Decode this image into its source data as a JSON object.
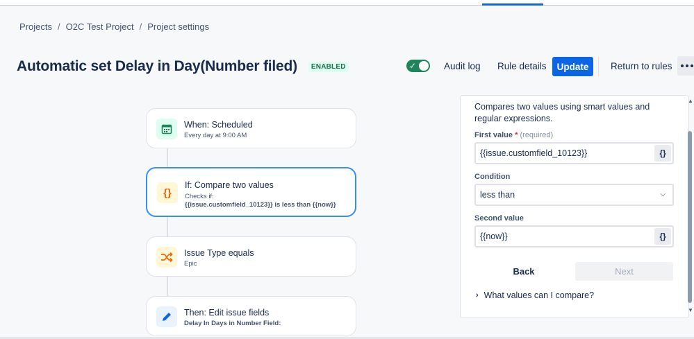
{
  "breadcrumb": [
    "Projects",
    "O2C Test Project",
    "Project settings"
  ],
  "header": {
    "title": "Automatic set Delay in Day(Number filed)",
    "status_badge": "ENABLED",
    "audit_log": "Audit log",
    "rule_details": "Rule details",
    "update": "Update",
    "return_to_rules": "Return to rules"
  },
  "rule_enabled": true,
  "components": [
    {
      "title": "When: Scheduled",
      "subtitle": "Every day at 9:00 AM",
      "icon": "calendar-icon"
    },
    {
      "title": "If: Compare two values",
      "subtitle": "Checks if:",
      "detail": "{{issue.customfield_10123}} is less than {{now}}",
      "icon": "curly-braces-icon"
    },
    {
      "title": "Issue Type equals",
      "subtitle": "Epic",
      "icon": "shuffle-icon"
    },
    {
      "title": "Then: Edit issue fields",
      "detail": "Delay In Days in Number Field:",
      "icon": "pencil-icon"
    }
  ],
  "panel": {
    "description": "Compares two values using smart values and regular expressions.",
    "first_value_label": "First value",
    "required_mark": "*",
    "required_text": "(required)",
    "first_value": "{{issue.customfield_10123}}",
    "condition_label": "Condition",
    "condition_value": "less than",
    "second_value_label": "Second value",
    "second_value": "{{now}}",
    "smart_value_button": "{}",
    "back": "Back",
    "next": "Next",
    "help_link": "What values can I compare?"
  },
  "colors": {
    "primary": "#0c66e4",
    "toggle_on": "#1f845a",
    "selected_border": "#388bff",
    "badge_bg": "#dcfff1",
    "badge_text": "#216e4e"
  }
}
